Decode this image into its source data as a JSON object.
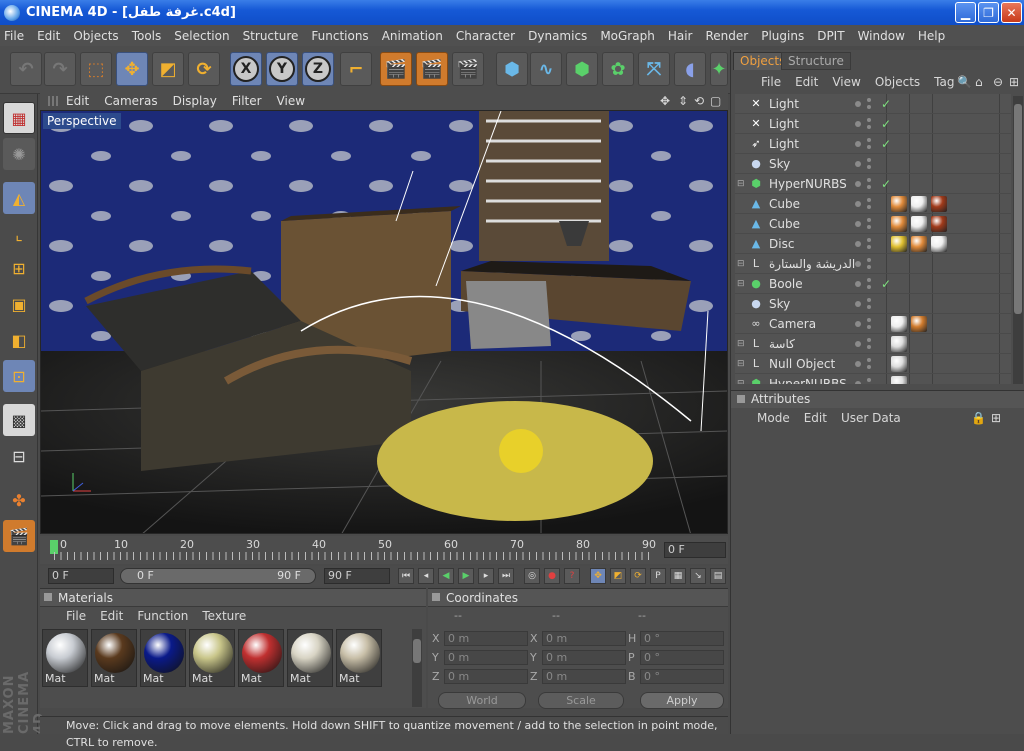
{
  "window": {
    "title": "CINEMA 4D - [غرفة طفل.c4d]"
  },
  "menu": [
    "File",
    "Edit",
    "Objects",
    "Tools",
    "Selection",
    "Structure",
    "Functions",
    "Animation",
    "Character",
    "Dynamics",
    "MoGraph",
    "Hair",
    "Render",
    "Plugins",
    "DPIT",
    "Window",
    "Help"
  ],
  "viewport": {
    "menu": [
      "Edit",
      "Cameras",
      "Display",
      "Filter",
      "View"
    ],
    "label": "Perspective"
  },
  "timeline": {
    "ticks": [
      "0",
      "10",
      "20",
      "30",
      "40",
      "50",
      "60",
      "70",
      "80",
      "90"
    ],
    "current_frame": "0 F"
  },
  "animbar": {
    "start": "0 F",
    "range_start": "0 F",
    "range_end": "90 F",
    "end": "90 F"
  },
  "materials": {
    "title": "Materials",
    "menu": [
      "File",
      "Edit",
      "Function",
      "Texture"
    ],
    "items": [
      {
        "label": "Mat",
        "color": "#c8ccd2"
      },
      {
        "label": "Mat",
        "color": "#5a3a1e"
      },
      {
        "label": "Mat",
        "color": "#0a1a8a"
      },
      {
        "label": "Mat",
        "color": "#c9c68a"
      },
      {
        "label": "Mat",
        "color": "#c03030"
      },
      {
        "label": "Mat",
        "color": "#d8d4c4"
      },
      {
        "label": "Mat",
        "color": "#c8bfa8"
      }
    ]
  },
  "coordinates": {
    "title": "Coordinates",
    "header": [
      "--",
      "--",
      "--"
    ],
    "rows": [
      {
        "a": "X",
        "av": "0 m",
        "b": "X",
        "bv": "0 m",
        "c": "H",
        "cv": "0 °"
      },
      {
        "a": "Y",
        "av": "0 m",
        "b": "Y",
        "bv": "0 m",
        "c": "P",
        "cv": "0 °"
      },
      {
        "a": "Z",
        "av": "0 m",
        "b": "Z",
        "bv": "0 m",
        "c": "B",
        "cv": "0 °"
      }
    ],
    "mode": "World",
    "scale": "Scale",
    "apply": "Apply"
  },
  "status": "Move: Click and drag to move elements. Hold down SHIFT to quantize movement / add to the selection in point mode, CTRL to remove.",
  "objects": {
    "tabs": [
      "Objects",
      "Structure"
    ],
    "menu": [
      "File",
      "Edit",
      "View",
      "Objects",
      "Tag"
    ],
    "items": [
      {
        "name": "Light",
        "icon": "light-icon",
        "check": "✓"
      },
      {
        "name": "Light",
        "icon": "light-icon",
        "check": "✓"
      },
      {
        "name": "Light",
        "icon": "spot-light-icon",
        "check": "✓"
      },
      {
        "name": "Sky",
        "icon": "sky-icon",
        "check": ""
      },
      {
        "name": "HyperNURBS",
        "icon": "hypernurbs-icon",
        "check": "✓"
      },
      {
        "name": "Cube",
        "icon": "cube-icon",
        "check": ""
      },
      {
        "name": "Cube",
        "icon": "cube-icon",
        "check": ""
      },
      {
        "name": "Disc",
        "icon": "disc-icon",
        "check": ""
      },
      {
        "name": "الدريشة والستارة",
        "icon": "null-icon",
        "check": ""
      },
      {
        "name": "Boole",
        "icon": "boole-icon",
        "check": "✓"
      },
      {
        "name": "Sky",
        "icon": "sky-icon",
        "check": ""
      },
      {
        "name": "Camera",
        "icon": "camera-icon",
        "check": ""
      },
      {
        "name": "كاسة",
        "icon": "null-icon",
        "check": ""
      },
      {
        "name": "Null Object",
        "icon": "null-icon",
        "check": ""
      },
      {
        "name": "HyperNURBS",
        "icon": "hypernurbs-icon",
        "check": ""
      }
    ]
  },
  "attributes": {
    "title": "Attributes",
    "menu": [
      "Mode",
      "Edit",
      "User Data"
    ]
  }
}
